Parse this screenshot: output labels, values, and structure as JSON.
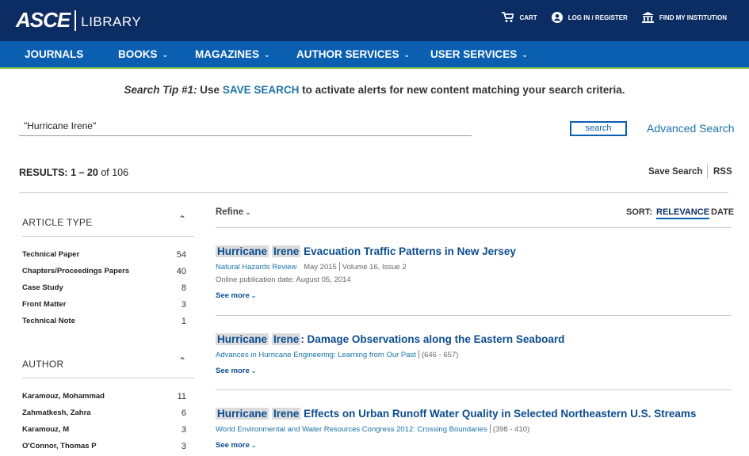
{
  "header": {
    "logo_main": "ASCE",
    "logo_sub": "LIBRARY",
    "cart_label": "CART",
    "login_label": "LOG IN / REGISTER",
    "institution_label": "FIND MY INSTITUTION"
  },
  "nav": {
    "items": [
      {
        "label": "JOURNALS",
        "has_dropdown": false
      },
      {
        "label": "BOOKS",
        "has_dropdown": true
      },
      {
        "label": "MAGAZINES",
        "has_dropdown": true
      },
      {
        "label": "AUTHOR SERVICES",
        "has_dropdown": true
      },
      {
        "label": "USER SERVICES",
        "has_dropdown": true
      }
    ]
  },
  "search_tip": {
    "prefix": "Search Tip #1:",
    "use": " Use ",
    "link": "SAVE SEARCH",
    "suffix": " to activate alerts for new content matching your search criteria."
  },
  "search": {
    "value": "\"Hurricane Irene\"",
    "button_label": "search",
    "advanced_label": "Advanced Search"
  },
  "results": {
    "label": "RESULTS:",
    "range": "1 – 20",
    "of_text": "of 106",
    "save_search": "Save Search",
    "rss": "RSS"
  },
  "facets": [
    {
      "title": "ARTICLE TYPE",
      "items": [
        {
          "label": "Technical Paper",
          "count": "54"
        },
        {
          "label": "Chapters/Proceedings Papers",
          "count": "40"
        },
        {
          "label": "Case Study",
          "count": "8"
        },
        {
          "label": "Front Matter",
          "count": "3"
        },
        {
          "label": "Technical Note",
          "count": "1"
        }
      ]
    },
    {
      "title": "AUTHOR",
      "items": [
        {
          "label": "Karamouz, Mohammad",
          "count": "11"
        },
        {
          "label": "Zahmatkesh, Zahra",
          "count": "6"
        },
        {
          "label": "Karamouz, M",
          "count": "3"
        },
        {
          "label": "O'Connor, Thomas P",
          "count": "3"
        }
      ]
    }
  ],
  "toolbar": {
    "refine": "Refine",
    "sort_label": "SORT:",
    "sort_relevance": "RELEVANCE",
    "sort_date": "DATE"
  },
  "items": [
    {
      "hl1": "Hurricane",
      "hl2": "Irene",
      "title_rest": " Evacuation Traffic Patterns in New Jersey",
      "source": "Natural Hazards Review",
      "detail1": "May 2015",
      "detail2": "Volume 16, Issue 2",
      "pub_date": "Online publication date: August 05, 2014",
      "see_more": "See more"
    },
    {
      "hl1": "Hurricane",
      "hl2": "Irene",
      "title_rest": ": Damage Observations along the Eastern Seaboard",
      "source": "Advances in Hurricane Engineering: Learning from Our Past",
      "detail1": "(646 - 657)",
      "see_more": "See more"
    },
    {
      "hl1": "Hurricane",
      "hl2": "Irene",
      "title_rest": " Effects on Urban Runoff Water Quality in Selected Northeastern U.S. Streams",
      "source": "World Environmental and Water Resources Congress 2012: Crossing Boundaries",
      "detail1": "(398 - 410)",
      "see_more": "See more"
    }
  ],
  "colors": {
    "header_bg": "#0b2d63",
    "nav_bg": "#0a5fb1",
    "nav_accent": "#8bc34a",
    "link": "#1a73a8",
    "title": "#0b4d8f"
  }
}
